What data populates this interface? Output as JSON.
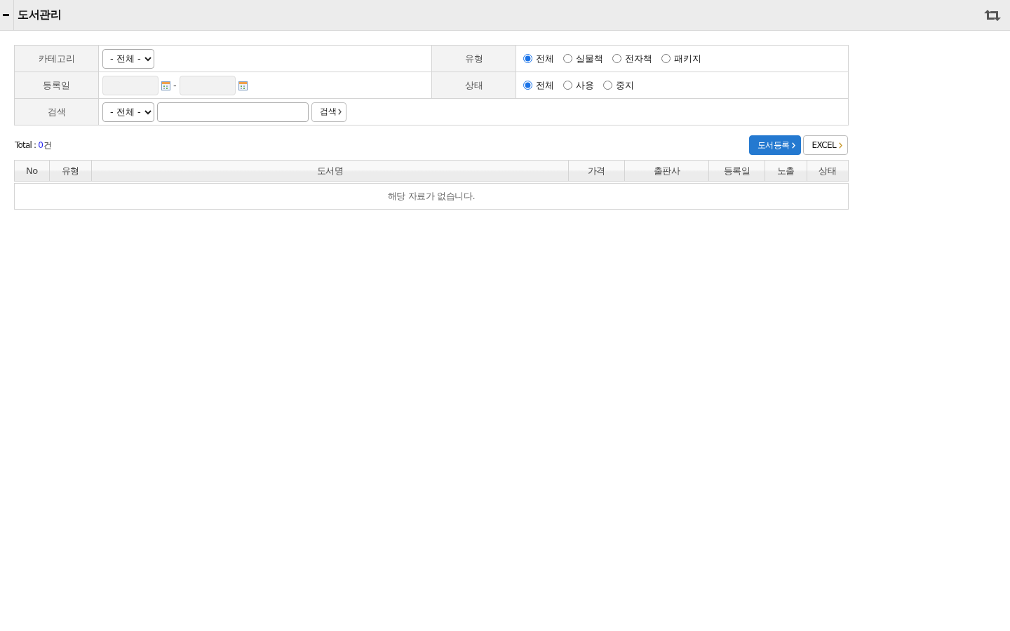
{
  "header": {
    "title": "도서관리"
  },
  "search_form": {
    "rows": [
      {
        "fields": [
          {
            "label": "카테고리",
            "kind": "select",
            "value": "- 전체 -"
          },
          {
            "label": "유형",
            "kind": "radio",
            "options": [
              {
                "label": "전체",
                "selected": true
              },
              {
                "label": "실물책",
                "selected": false
              },
              {
                "label": "전자책",
                "selected": false
              },
              {
                "label": "패키지",
                "selected": false
              }
            ]
          }
        ]
      },
      {
        "fields": [
          {
            "label": "등록일",
            "kind": "date_range",
            "separator": "-"
          },
          {
            "label": "상태",
            "kind": "radio",
            "options": [
              {
                "label": "전체",
                "selected": true
              },
              {
                "label": "사용",
                "selected": false
              },
              {
                "label": "중지",
                "selected": false
              }
            ]
          }
        ]
      },
      {
        "fields": [
          {
            "label": "검색",
            "kind": "search",
            "value": "- 전체 -",
            "button": "검색"
          }
        ]
      }
    ]
  },
  "list_toolbar": {
    "total": {
      "label": "Total :",
      "count": "0",
      "unit": "건"
    },
    "buttons": [
      {
        "label": "도서등록",
        "kind": "primary"
      },
      {
        "label": "EXCEL",
        "kind": "default"
      }
    ]
  },
  "table": {
    "columns": [
      "No",
      "유형",
      "도서명",
      "가격",
      "출판사",
      "등록일",
      "노출",
      "상태"
    ],
    "empty_message": "해당 자료가 없습니다."
  }
}
